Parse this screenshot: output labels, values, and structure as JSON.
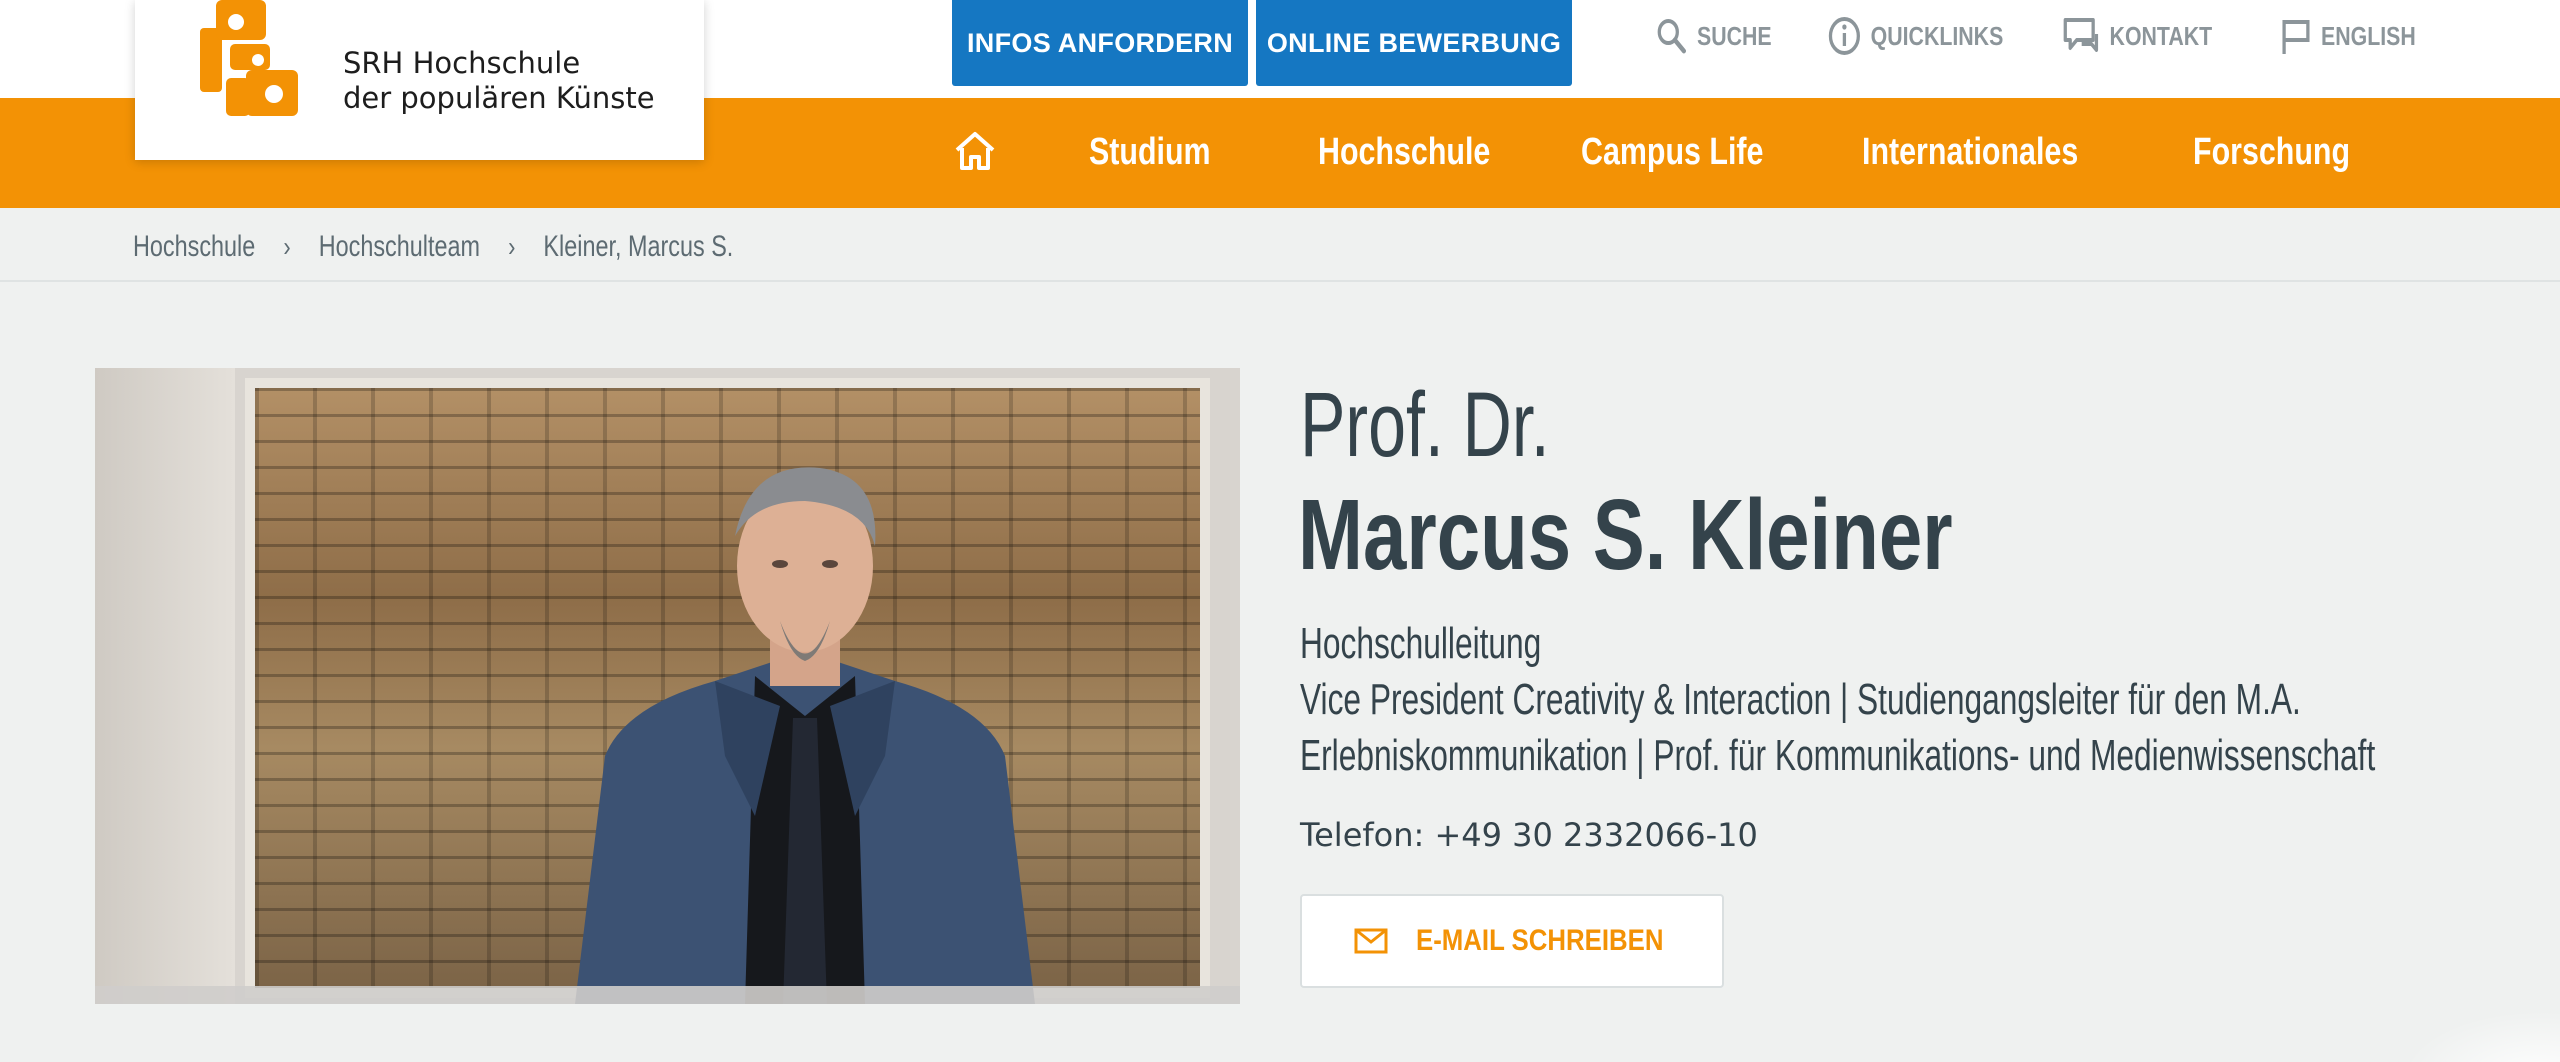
{
  "brand": {
    "name_line1": "SRH Hochschule",
    "name_line2": "der populären Künste",
    "accent_orange": "#f39205",
    "accent_blue": "#1577c2",
    "text_dark": "#34434b"
  },
  "header": {
    "cta_infos": "INFOS ANFORDERN",
    "cta_online": "ONLINE BEWERBUNG",
    "utility": [
      {
        "label": "SUCHE",
        "icon": "search-icon"
      },
      {
        "label": "QUICKLINKS",
        "icon": "info-icon"
      },
      {
        "label": "KONTAKT",
        "icon": "chat-icon"
      },
      {
        "label": "ENGLISH",
        "icon": "flag-icon"
      }
    ]
  },
  "nav": {
    "home_icon": "home-icon",
    "items": [
      "Studium",
      "Hochschule",
      "Campus Life",
      "Internationales",
      "Forschung"
    ]
  },
  "breadcrumb": [
    "Hochschule",
    "Hochschulteam",
    "Kleiner, Marcus S."
  ],
  "profile": {
    "title": "Prof. Dr.",
    "name": "Marcus S. Kleiner",
    "role_line1": "Hochschulleitung",
    "role_line2": "Vice President Creativity & Interaction | Studiengangsleiter für den M.A.",
    "role_line3": "Erlebniskommunikation | Prof. für Kommunikations- und Medienwissenschaft",
    "phone": "Telefon: +49 30 2332066-10",
    "email_button": "E-MAIL SCHREIBEN",
    "email_icon": "mail-icon"
  }
}
